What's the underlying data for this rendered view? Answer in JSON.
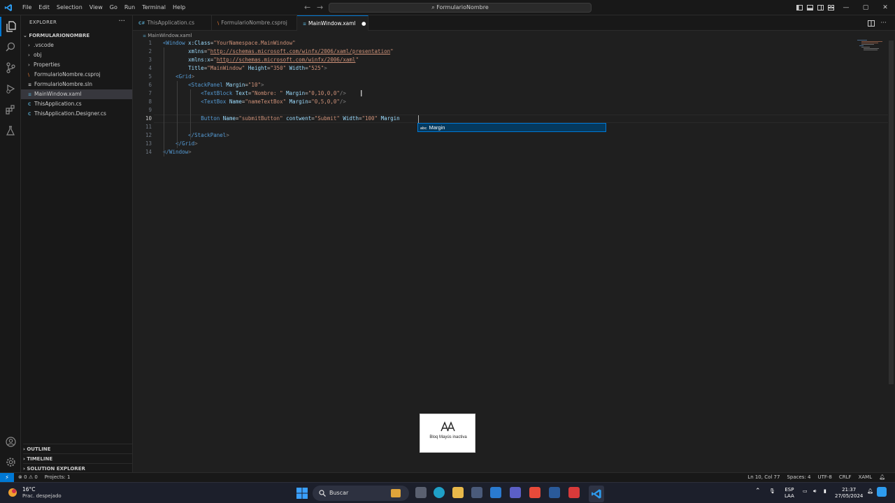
{
  "menu": [
    "File",
    "Edit",
    "Selection",
    "View",
    "Go",
    "Run",
    "Terminal",
    "Help"
  ],
  "command_center": "FormularioNombre",
  "sidebar": {
    "header": "EXPLORER",
    "root": "FORMULARIONOMBRE",
    "items": [
      {
        "label": ".vscode",
        "kind": "folder"
      },
      {
        "label": "obj",
        "kind": "folder"
      },
      {
        "label": "Properties",
        "kind": "folder"
      },
      {
        "label": "FormularioNombre.csproj",
        "kind": "csproj"
      },
      {
        "label": "FormularioNombre.sln",
        "kind": "sln"
      },
      {
        "label": "MainWindow.xaml",
        "kind": "xaml",
        "selected": true
      },
      {
        "label": "ThisApplication.cs",
        "kind": "cs"
      },
      {
        "label": "ThisApplication.Designer.cs",
        "kind": "cs"
      }
    ],
    "sections": [
      "OUTLINE",
      "TIMELINE",
      "SOLUTION EXPLORER"
    ]
  },
  "tabs": [
    {
      "label": "ThisApplication.cs",
      "icon": "C#",
      "color": "#519aba"
    },
    {
      "label": "FormularioNombre.csproj",
      "icon": "rss",
      "color": "#e37933"
    },
    {
      "label": "MainWindow.xaml",
      "icon": "xaml",
      "color": "#519aba",
      "active": true,
      "dirty": true
    }
  ],
  "breadcrumb": "MainWindow.xaml",
  "editor": {
    "line_numbers": [
      "1",
      "2",
      "3",
      "4",
      "5",
      "6",
      "7",
      "8",
      "9",
      "10",
      "11",
      "12",
      "13",
      "14"
    ],
    "current_line": "10",
    "lines": [
      [
        [
          "tag",
          "<Window"
        ],
        [
          "eq",
          " "
        ],
        [
          "attr",
          "x:Class"
        ],
        [
          "eq",
          "="
        ],
        [
          "str",
          "\"YourNamespace.MainWindow\""
        ]
      ],
      [
        [
          "eq",
          "        "
        ],
        [
          "attr",
          "xmlns"
        ],
        [
          "eq",
          "="
        ],
        [
          "str",
          "\""
        ],
        [
          "url",
          "http://schemas.microsoft.com/winfx/2006/xaml/presentation"
        ],
        [
          "str",
          "\""
        ]
      ],
      [
        [
          "eq",
          "        "
        ],
        [
          "attr",
          "xmlns:x"
        ],
        [
          "eq",
          "="
        ],
        [
          "str",
          "\""
        ],
        [
          "url",
          "http://schemas.microsoft.com/winfx/2006/xaml"
        ],
        [
          "str",
          "\""
        ]
      ],
      [
        [
          "eq",
          "        "
        ],
        [
          "attr",
          "Title"
        ],
        [
          "eq",
          "="
        ],
        [
          "str",
          "\"MainWindow\""
        ],
        [
          "eq",
          " "
        ],
        [
          "attr",
          "Height"
        ],
        [
          "eq",
          "="
        ],
        [
          "str",
          "\"350\""
        ],
        [
          "eq",
          " "
        ],
        [
          "attr",
          "Width"
        ],
        [
          "eq",
          "="
        ],
        [
          "str",
          "\"525\""
        ],
        [
          "punc",
          ">"
        ]
      ],
      [
        [
          "eq",
          "    "
        ],
        [
          "tag",
          "<Grid"
        ],
        [
          "punc",
          ">"
        ]
      ],
      [
        [
          "eq",
          "        "
        ],
        [
          "tag",
          "<StackPanel"
        ],
        [
          "eq",
          " "
        ],
        [
          "attr",
          "Margin"
        ],
        [
          "eq",
          "="
        ],
        [
          "str",
          "\"10\""
        ],
        [
          "punc",
          ">"
        ]
      ],
      [
        [
          "eq",
          "            "
        ],
        [
          "tag",
          "<TextBlock"
        ],
        [
          "eq",
          " "
        ],
        [
          "attr",
          "Text"
        ],
        [
          "eq",
          "="
        ],
        [
          "str",
          "\"Nombre: \""
        ],
        [
          "eq",
          " "
        ],
        [
          "attr",
          "Margin"
        ],
        [
          "eq",
          "="
        ],
        [
          "str",
          "\"0,10,0,0\""
        ],
        [
          "punc",
          "/>"
        ]
      ],
      [
        [
          "eq",
          "            "
        ],
        [
          "tag",
          "<TextBox"
        ],
        [
          "eq",
          " "
        ],
        [
          "attr",
          "Name"
        ],
        [
          "eq",
          "="
        ],
        [
          "str",
          "\"nameTextBox\""
        ],
        [
          "eq",
          " "
        ],
        [
          "attr",
          "Margin"
        ],
        [
          "eq",
          "="
        ],
        [
          "str",
          "\"0,5,0,0\""
        ],
        [
          "punc",
          "/>"
        ]
      ],
      [
        [
          "eq",
          ""
        ]
      ],
      [
        [
          "eq",
          "            "
        ],
        [
          "tag",
          "Button"
        ],
        [
          "eq",
          " "
        ],
        [
          "attr",
          "Name"
        ],
        [
          "eq",
          "="
        ],
        [
          "str",
          "\"submitButton\""
        ],
        [
          "eq",
          " "
        ],
        [
          "attr",
          "contwent"
        ],
        [
          "eq",
          "="
        ],
        [
          "str",
          "\"Submit\""
        ],
        [
          "eq",
          " "
        ],
        [
          "attr",
          "Width"
        ],
        [
          "eq",
          "="
        ],
        [
          "str",
          "\"100\""
        ],
        [
          "eq",
          " "
        ],
        [
          "attr",
          "Margin"
        ]
      ],
      [
        [
          "eq",
          ""
        ]
      ],
      [
        [
          "eq",
          "        "
        ],
        [
          "tag",
          "</StackPanel"
        ],
        [
          "punc",
          ">"
        ]
      ],
      [
        [
          "eq",
          "    "
        ],
        [
          "tag",
          "</Grid"
        ],
        [
          "punc",
          ">"
        ]
      ],
      [
        [
          "tag",
          "</Window"
        ],
        [
          "punc",
          ">"
        ]
      ]
    ],
    "suggestion": {
      "kind": "abc",
      "label": "Margin"
    }
  },
  "caps_overlay": {
    "text": "Bloq Mayús inactiva"
  },
  "status": {
    "problems": "0",
    "warnings": "0",
    "projects": "Projects: 1",
    "ln_col": "Ln 10, Col 77",
    "spaces": "Spaces: 4",
    "encoding": "UTF-8",
    "eol": "CRLF",
    "language": "XAML"
  },
  "taskbar": {
    "temperature": "16°C",
    "condition": "Prac. despejado",
    "search_placeholder": "Buscar",
    "lang_top": "ESP",
    "lang_bottom": "LAA",
    "time": "21:37",
    "date": "27/05/2024"
  },
  "colors": {
    "accent": "#0078d4",
    "editor_bg": "#1f1f1f",
    "tag": "#569cd6",
    "attr": "#9cdcfe",
    "string": "#ce9178"
  }
}
